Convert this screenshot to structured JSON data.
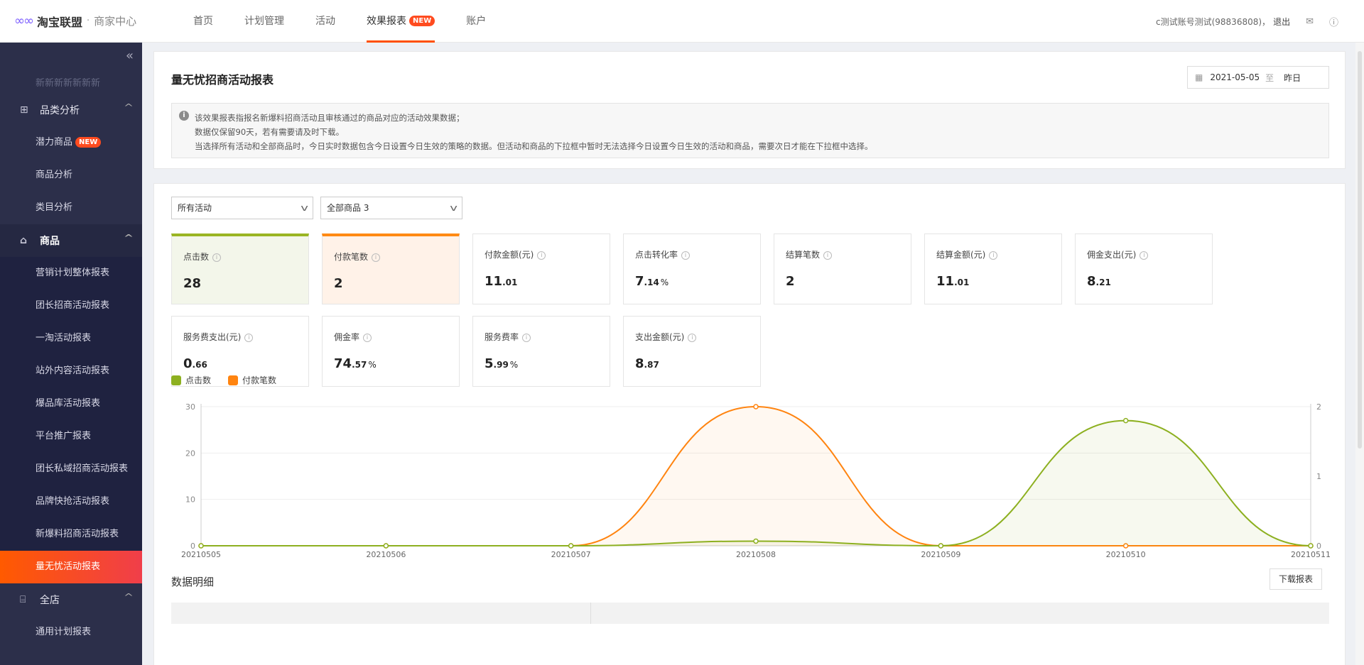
{
  "header": {
    "logo_mark": "∞∞",
    "brand": "淘宝联盟",
    "separator": "·",
    "subtitle": "商家中心",
    "nav": [
      {
        "label": "首页"
      },
      {
        "label": "计划管理"
      },
      {
        "label": "活动"
      },
      {
        "label": "效果报表",
        "badge": "NEW"
      },
      {
        "label": "账户"
      }
    ],
    "user": "c测试账号测试(98836808)",
    "logout": "退出"
  },
  "sidebar": {
    "cut_text": "新新新新新新新",
    "groups": [
      {
        "label": "品类分析",
        "items": [
          {
            "label": "潜力商品",
            "badge": "NEW"
          },
          {
            "label": "商品分析"
          },
          {
            "label": "类目分析"
          }
        ]
      },
      {
        "label": "商品",
        "items": [
          {
            "label": "营销计划整体报表"
          },
          {
            "label": "团长招商活动报表"
          },
          {
            "label": "一淘活动报表"
          },
          {
            "label": "站外内容活动报表"
          },
          {
            "label": "爆品库活动报表"
          },
          {
            "label": "平台推广报表"
          },
          {
            "label": "团长私域招商活动报表"
          },
          {
            "label": "品牌快抢活动报表"
          },
          {
            "label": "新爆料招商活动报表"
          },
          {
            "label": "量无忧活动报表"
          }
        ]
      },
      {
        "label": "全店",
        "items": [
          {
            "label": "通用计划报表"
          }
        ]
      }
    ]
  },
  "report": {
    "title": "量无忧招商活动报表",
    "date_start": "2021-05-05",
    "date_to": "至",
    "date_end": "昨日",
    "notice": [
      "该效果报表指报名新爆料招商活动且审核通过的商品对应的活动效果数据；",
      "数据仅保留90天，若有需要请及时下载。",
      "当选择所有活动和全部商品时，今日实时数据包含今日设置今日生效的策略的数据。但活动和商品的下拉框中暂时无法选择今日设置今日生效的活动和商品，需要次日才能在下拉框中选择。"
    ],
    "filter_activity": "所有活动",
    "filter_goods": "全部商品 3",
    "kpis": [
      {
        "label": "点击数",
        "int": "28",
        "dec": "",
        "pct": ""
      },
      {
        "label": "付款笔数",
        "int": "2",
        "dec": "",
        "pct": ""
      },
      {
        "label": "付款金额(元)",
        "int": "11",
        "dec": ".01",
        "pct": ""
      },
      {
        "label": "点击转化率",
        "int": "7",
        "dec": ".14",
        "pct": "%"
      },
      {
        "label": "结算笔数",
        "int": "2",
        "dec": "",
        "pct": ""
      },
      {
        "label": "结算金额(元)",
        "int": "11",
        "dec": ".01",
        "pct": ""
      },
      {
        "label": "佣金支出(元)",
        "int": "8",
        "dec": ".21",
        "pct": ""
      },
      {
        "label": "服务费支出(元)",
        "int": "0",
        "dec": ".66",
        "pct": ""
      },
      {
        "label": "佣金率",
        "int": "74",
        "dec": ".57",
        "pct": "%"
      },
      {
        "label": "服务费率",
        "int": "5",
        "dec": ".99",
        "pct": "%"
      },
      {
        "label": "支出金额(元)",
        "int": "8",
        "dec": ".87",
        "pct": ""
      }
    ],
    "detail_title": "数据明细",
    "download": "下载报表"
  },
  "colors": {
    "green": "#8db020",
    "orange": "#ff8410",
    "active_start": "#ff5a00",
    "active_end": "#f03e4a"
  },
  "chart_data": {
    "type": "line",
    "x": [
      "20210505",
      "20210506",
      "20210507",
      "20210508",
      "20210509",
      "20210510",
      "20210511"
    ],
    "series": [
      {
        "name": "点击数",
        "axis": "left",
        "values": [
          0,
          0,
          0,
          1,
          0,
          27,
          0
        ]
      },
      {
        "name": "付款笔数",
        "axis": "right",
        "values": [
          0,
          0,
          0,
          2,
          0,
          0,
          0
        ]
      }
    ],
    "y_left_ticks": [
      0,
      10,
      20,
      30
    ],
    "y_left_range": [
      0,
      30
    ],
    "y_right_ticks": [
      0,
      1,
      2
    ],
    "y_right_range": [
      0,
      2
    ],
    "legend": "top-left"
  }
}
